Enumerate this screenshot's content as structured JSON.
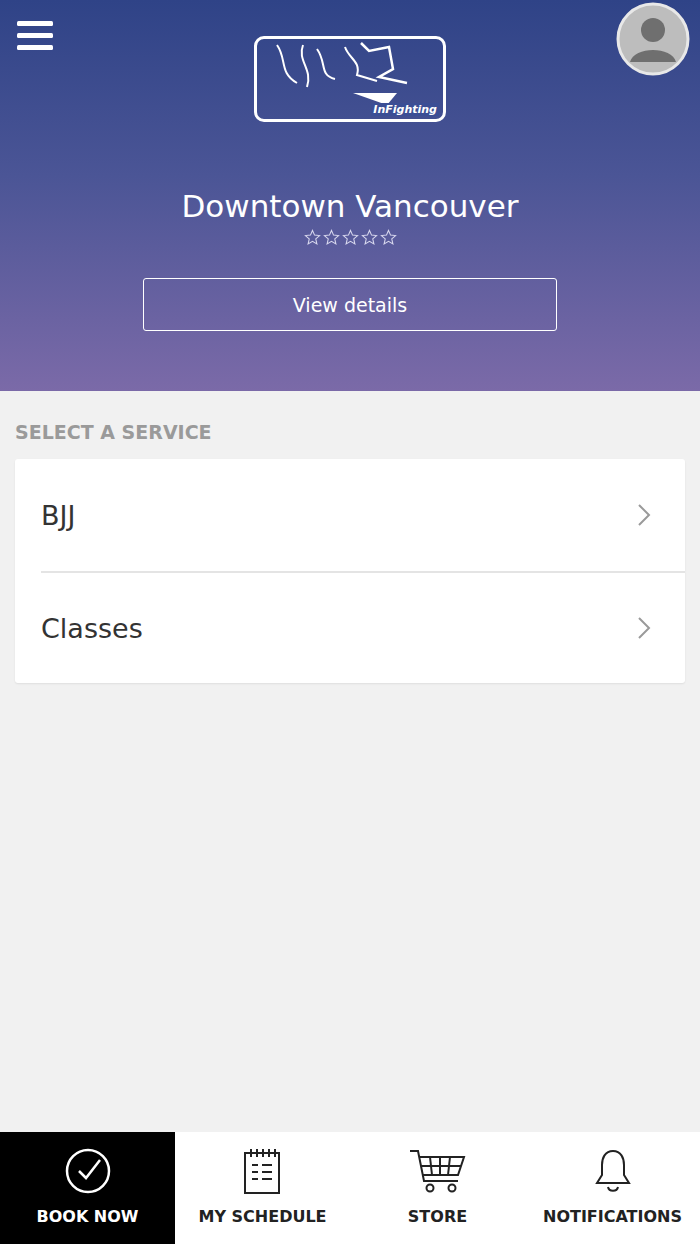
{
  "header": {
    "logo": "InFighting",
    "location": "Downtown Vancouver",
    "stars": 0,
    "button": "View details"
  },
  "section_label": "SELECT A SERVICE",
  "services": [
    {
      "label": "BJJ"
    },
    {
      "label": "Classes"
    }
  ],
  "nav": [
    {
      "label": "BOOK NOW",
      "selected": true
    },
    {
      "label": "MY SCHEDULE",
      "selected": false
    },
    {
      "label": "STORE",
      "selected": false
    },
    {
      "label": "NOTIFICATIONS",
      "selected": false
    }
  ]
}
